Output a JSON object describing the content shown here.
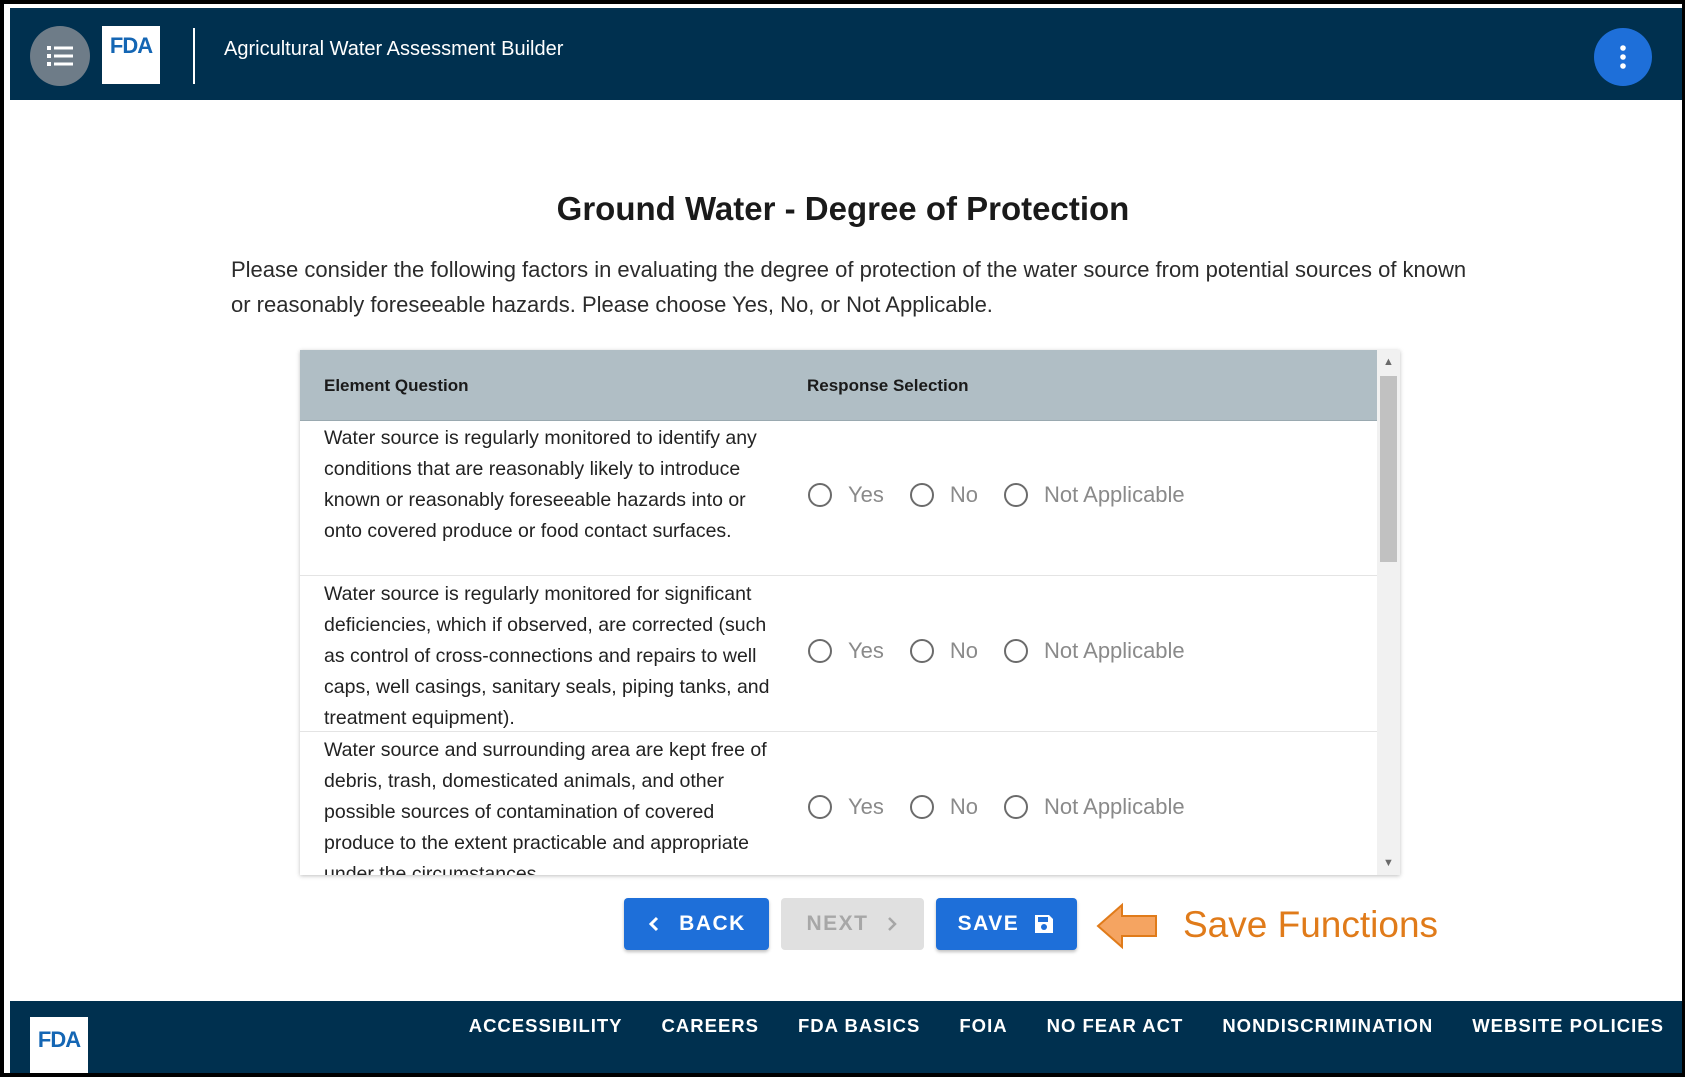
{
  "header": {
    "logo_text": "FDA",
    "app_title": "Agricultural Water Assessment Builder",
    "menu_icon": "list-menu-icon",
    "more_icon": "more-vertical-icon",
    "bar_color": "#00304f"
  },
  "main": {
    "title": "Ground Water - Degree of Protection",
    "intro": "Please consider the following factors in evaluating the degree of protection of the water source from potential sources of known or reasonably foreseeable hazards. Please choose Yes, No, or Not Applicable."
  },
  "table": {
    "columns": [
      "Element Question",
      "Response Selection"
    ],
    "options": [
      "Yes",
      "No",
      "Not Applicable"
    ],
    "rows": [
      {
        "question": "Water source is regularly monitored to identify any conditions that are reasonably likely to introduce known or reasonably foreseeable hazards into or onto covered produce or food contact surfaces."
      },
      {
        "question": "Water source is regularly monitored for significant deficiencies, which if observed, are corrected (such as control of cross-connections and repairs to well caps, well casings, sanitary seals, piping tanks, and treatment equipment)."
      },
      {
        "question": "Water source and surrounding area are kept free of debris, trash, domesticated animals, and other possible sources of contamination of covered produce to the extent practicable and appropriate under the circumstances."
      }
    ]
  },
  "actions": {
    "back_label": "BACK",
    "next_label": "NEXT",
    "save_label": "SAVE",
    "primary_color": "#1e6fd9"
  },
  "annotation": {
    "callout_text": "Save Functions",
    "callout_color": "#e07b1a"
  },
  "footer": {
    "logo_text": "FDA",
    "links": [
      "ACCESSIBILITY",
      "CAREERS",
      "FDA BASICS",
      "FOIA",
      "NO FEAR ACT",
      "NONDISCRIMINATION",
      "WEBSITE POLICIES"
    ]
  }
}
